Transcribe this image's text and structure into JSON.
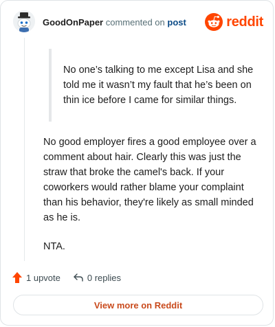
{
  "header": {
    "username": "GoodOnPaper",
    "action_text": "commented on",
    "post_link": "post",
    "logo_text": "reddit"
  },
  "comment": {
    "quote": "No one’s talking to me except Lisa and she told me it wasn’t my fault that he’s been on thin ice before I came for similar things.",
    "paragraphs": [
      "No good employer fires a good employee over a comment about hair. Clearly this was just the straw that broke the camel's back. If your coworkers would rather blame your complaint than his behavior, they're likely as small minded as he is.",
      "NTA."
    ]
  },
  "actions": {
    "upvote_label": "1 upvote",
    "replies_label": "0 replies"
  },
  "cta": {
    "label": "View more on Reddit"
  },
  "colors": {
    "brand": "#ff4500",
    "link": "#0a4a86",
    "upvote": "#ff4500"
  },
  "icons": {
    "avatar": "snoo-avatar",
    "logo": "reddit-snoo-icon",
    "upvote": "upvote-arrow-icon",
    "reply": "reply-arrow-icon"
  }
}
